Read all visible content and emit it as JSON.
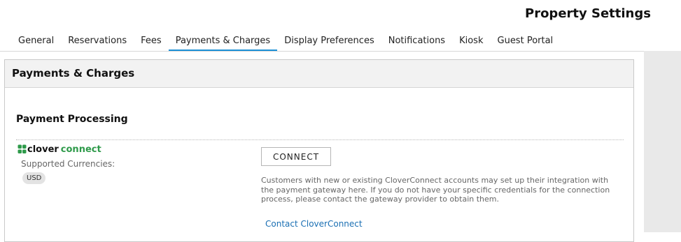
{
  "header": {
    "title": "Property Settings"
  },
  "tabs": [
    {
      "label": "General",
      "active": false
    },
    {
      "label": "Reservations",
      "active": false
    },
    {
      "label": "Fees",
      "active": false
    },
    {
      "label": "Payments & Charges",
      "active": true
    },
    {
      "label": "Display Preferences",
      "active": false
    },
    {
      "label": "Notifications",
      "active": false
    },
    {
      "label": "Kiosk",
      "active": false
    },
    {
      "label": "Guest Portal",
      "active": false
    }
  ],
  "panel": {
    "title": "Payments & Charges",
    "section_title": "Payment Processing",
    "provider": {
      "logo_word1": "clover",
      "logo_word2": "connect",
      "logo_icon": "clover-leaf-icon",
      "currencies_label": "Supported Currencies:",
      "currencies": [
        "USD"
      ],
      "connect_label": "CONNECT",
      "description": "Customers with new or existing CloverConnect accounts may set up their integration with the payment gateway here. If you do not have your specific credentials for the connection process, please contact the gateway provider to obtain them.",
      "contact_link": "Contact CloverConnect"
    }
  },
  "colors": {
    "accent": "#1a8fd6",
    "brand_green": "#2e9a4a",
    "link": "#1a6fb3",
    "side_strip": "#e9e9e9"
  }
}
